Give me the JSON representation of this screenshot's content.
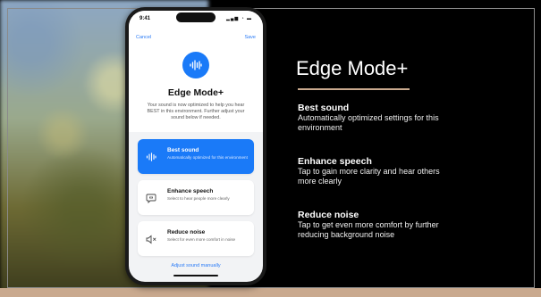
{
  "phone": {
    "status_time": "9:41",
    "status_icons": "▂▄▆ ◔ ▬",
    "nav": {
      "cancel_label": "Cancel",
      "save_label": "Save"
    },
    "hero_title": "Edge Mode+",
    "hero_description": "Your sound is now optimized to help you hear BEST in this environment. Further adjust your sound below if needed.",
    "options": [
      {
        "title": "Best sound",
        "description": "Automatically optimized for this environment",
        "selected": true,
        "icon": "waveform-icon"
      },
      {
        "title": "Enhance speech",
        "description": "Select to hear people more clearly",
        "selected": false,
        "icon": "speech-bubble-icon"
      },
      {
        "title": "Reduce noise",
        "description": "Select for even more comfort in noise",
        "selected": false,
        "icon": "speaker-icon"
      }
    ],
    "adjust_link": "Adjust sound manually"
  },
  "slide": {
    "title": "Edge Mode+",
    "accent_color": "#c9a98e",
    "features": [
      {
        "title": "Best sound",
        "description": "Automatically optimized settings for this environment"
      },
      {
        "title": "Enhance speech",
        "description": "Tap to gain more clarity and hear others more clearly"
      },
      {
        "title": "Reduce noise",
        "description": "Tap to get even more comfort by further reducing background noise"
      }
    ]
  },
  "colors": {
    "brand_blue": "#1a7af8",
    "background": "#000000"
  }
}
